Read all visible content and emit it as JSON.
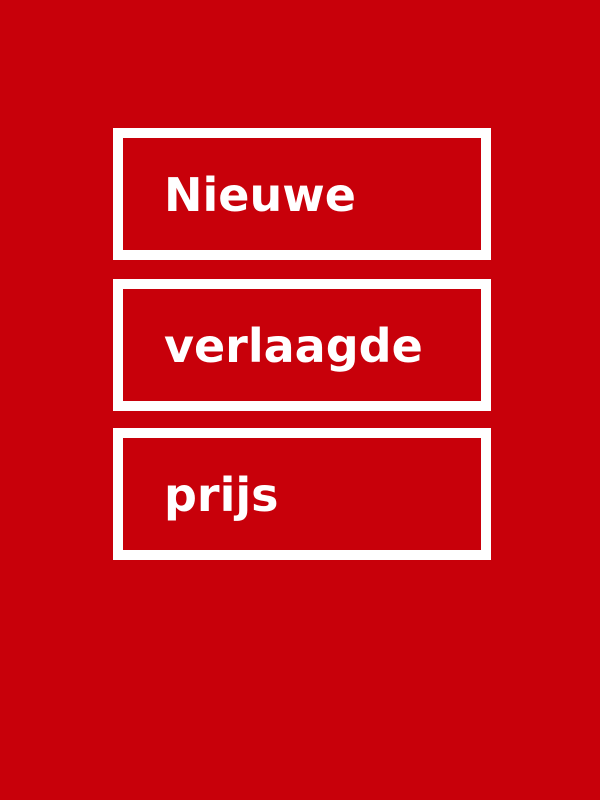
{
  "banner": {
    "background_color": "#c8000a",
    "text_color": "#ffffff",
    "lines": [
      "Nieuwe",
      "verlaagde",
      "prijs"
    ]
  }
}
